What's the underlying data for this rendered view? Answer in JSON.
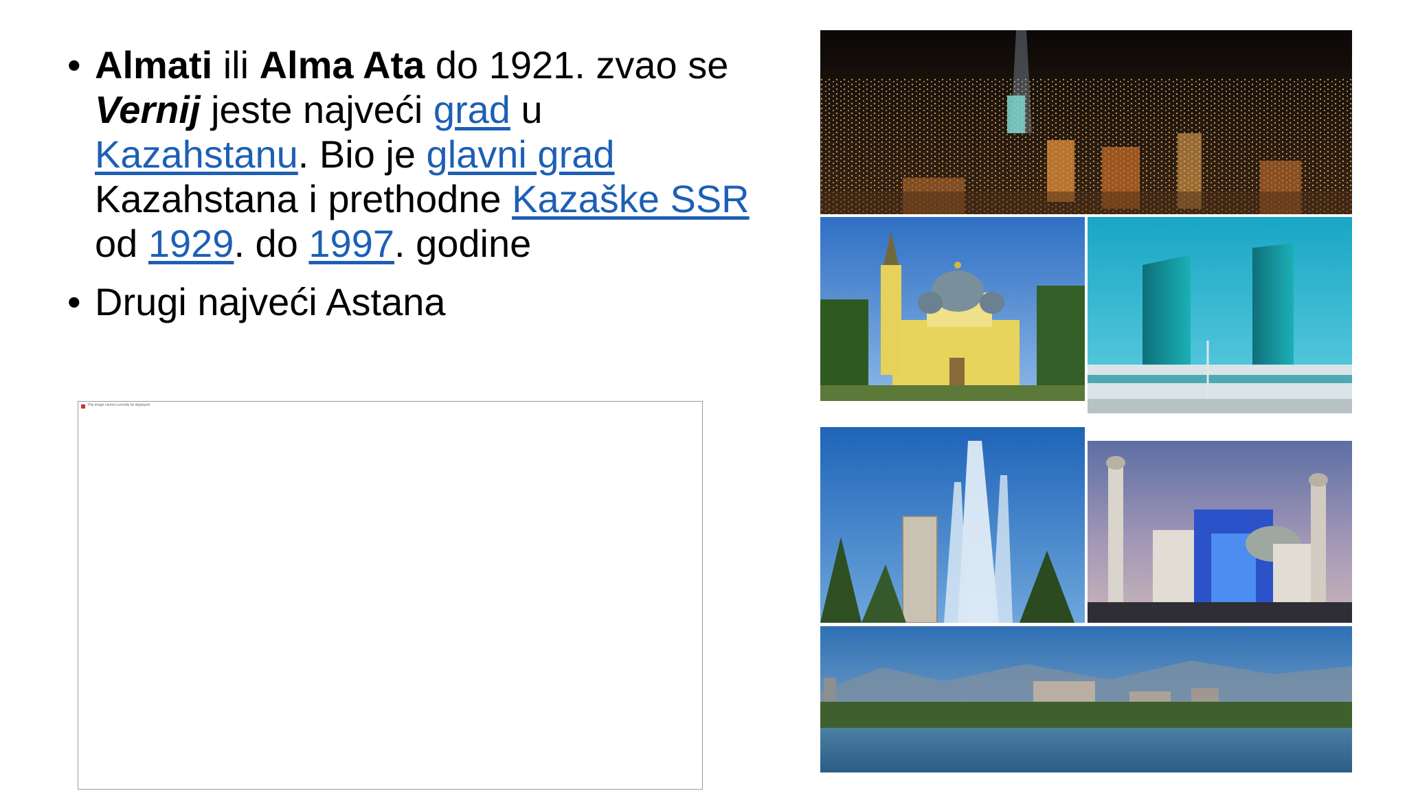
{
  "bullets": {
    "b1": {
      "almati": "Almati",
      "t_ili": " ili ",
      "alma_ata": "Alma Ata",
      "t_zvao": " do 1921. zvao se ",
      "vernij": "Vernij",
      "t_jeste": " jeste najveći ",
      "link_grad": "grad",
      "t_u": " u ",
      "link_kazahstanu": "Kazahstanu",
      "t_bio": ". Bio je ",
      "link_glavni_grad": "glavni grad",
      "t_kazahstana": " Kazahstana i prethodne ",
      "link_kazaske_ssr": "Kazaške SSR",
      "t_od": " od ",
      "link_1929": "1929",
      "t_do": ". do ",
      "link_1997": "1997",
      "t_godine": ". godine"
    },
    "b2": "Drugi najveći Astana"
  },
  "broken_image": {
    "alt": "This image cannot currently be displayed."
  },
  "colors": {
    "link": "#1d5fb5",
    "text": "#000000",
    "background": "#ffffff"
  }
}
